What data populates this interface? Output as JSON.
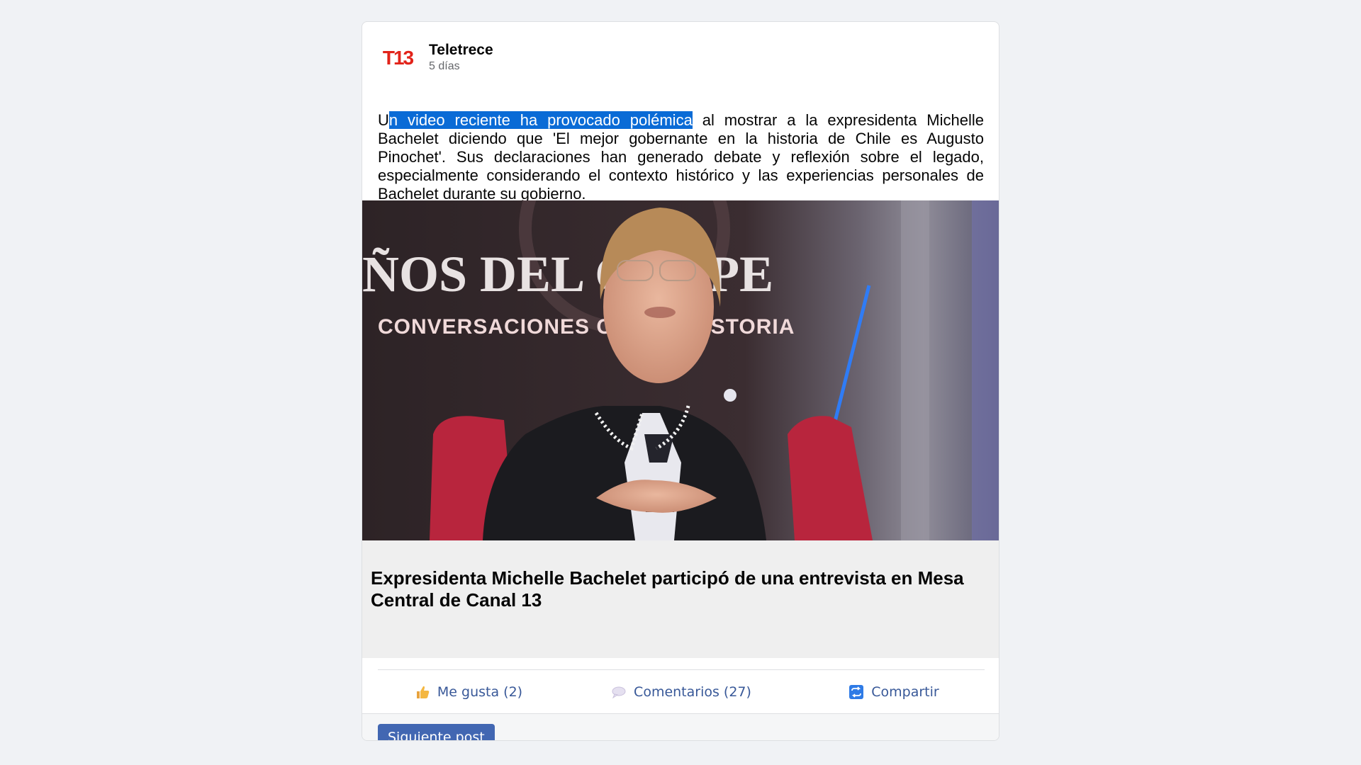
{
  "post": {
    "author": "Teletrece",
    "time": "5 días",
    "avatar_logo": "T13",
    "body_selected": "n video reciente ha provocado polémica",
    "body_first_letter": "U",
    "body_rest": " al mostrar a la expresidenta Michelle Bachelet diciendo que 'El mejor gobernante en la historia de Chile es Augusto Pinochet'. Sus declaraciones han generado debate y reflexión sobre el legado, especialmente considerando el contexto histórico y las experiencias personales de Bachelet durante su gobierno.",
    "image_caption_big": "ÑOS DEL GOLPE",
    "image_caption_small": "CONVERSACIONES CON LA HISTORIA",
    "link_title": "Expresidenta Michelle Bachelet participó de una entrevista en Mesa Central de Canal 13"
  },
  "actions": {
    "like": {
      "icon": "thumbs-up-icon",
      "label": "Me gusta (2)"
    },
    "comment": {
      "icon": "speech-bubble-icon",
      "label": "Comentarios (27)"
    },
    "share": {
      "icon": "share-icon",
      "label": "Compartir"
    }
  },
  "footer": {
    "next_label": "Siguiente post"
  },
  "colors": {
    "accent": "#4267b2",
    "link": "#385898",
    "selection": "#0a6bd6",
    "logo_red": "#e2231a"
  }
}
